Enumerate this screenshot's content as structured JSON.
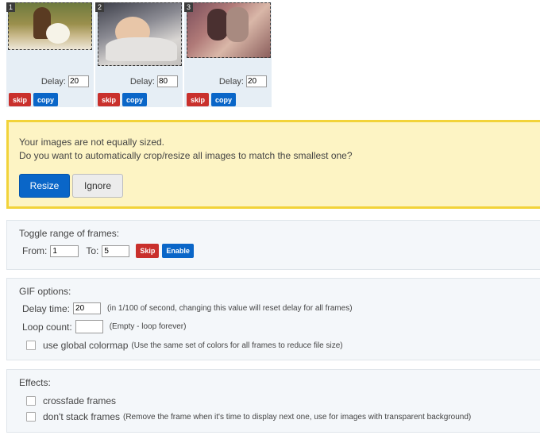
{
  "frames": [
    {
      "number": "1",
      "delay_label": "Delay:",
      "delay_value": "20",
      "skip_label": "skip",
      "copy_label": "copy"
    },
    {
      "number": "2",
      "delay_label": "Delay:",
      "delay_value": "80",
      "skip_label": "skip",
      "copy_label": "copy"
    },
    {
      "number": "3",
      "delay_label": "Delay:",
      "delay_value": "20",
      "skip_label": "skip",
      "copy_label": "copy"
    }
  ],
  "warning": {
    "line1": "Your images are not equally sized.",
    "line2": "Do you want to automatically crop/resize all images to match the smallest one?",
    "resize_label": "Resize",
    "ignore_label": "Ignore"
  },
  "toggle_range": {
    "title": "Toggle range of frames:",
    "from_label": "From:",
    "from_value": "1",
    "to_label": "To:",
    "to_value": "5",
    "skip_label": "Skip",
    "enable_label": "Enable"
  },
  "gif_options": {
    "title": "GIF options:",
    "delay_label": "Delay time:",
    "delay_value": "20",
    "delay_note": "(in 1/100 of second, changing this value will reset delay for all frames)",
    "loop_label": "Loop count:",
    "loop_value": "",
    "loop_note": "(Empty - loop forever)",
    "colormap_label": "use global colormap",
    "colormap_note": "(Use the same set of colors for all frames to reduce file size)"
  },
  "effects": {
    "title": "Effects:",
    "crossfade_label": "crossfade frames",
    "nostack_label": "don't stack frames",
    "nostack_note": "(Remove the frame when it's time to display next one, use for images with transparent background)"
  },
  "colors": {
    "accent_blue": "#0a66c8",
    "danger_red": "#c9302c",
    "warning_bg": "#fdf4c4",
    "warning_border": "#f2d33a",
    "panel_bg": "#f4f7fa"
  }
}
